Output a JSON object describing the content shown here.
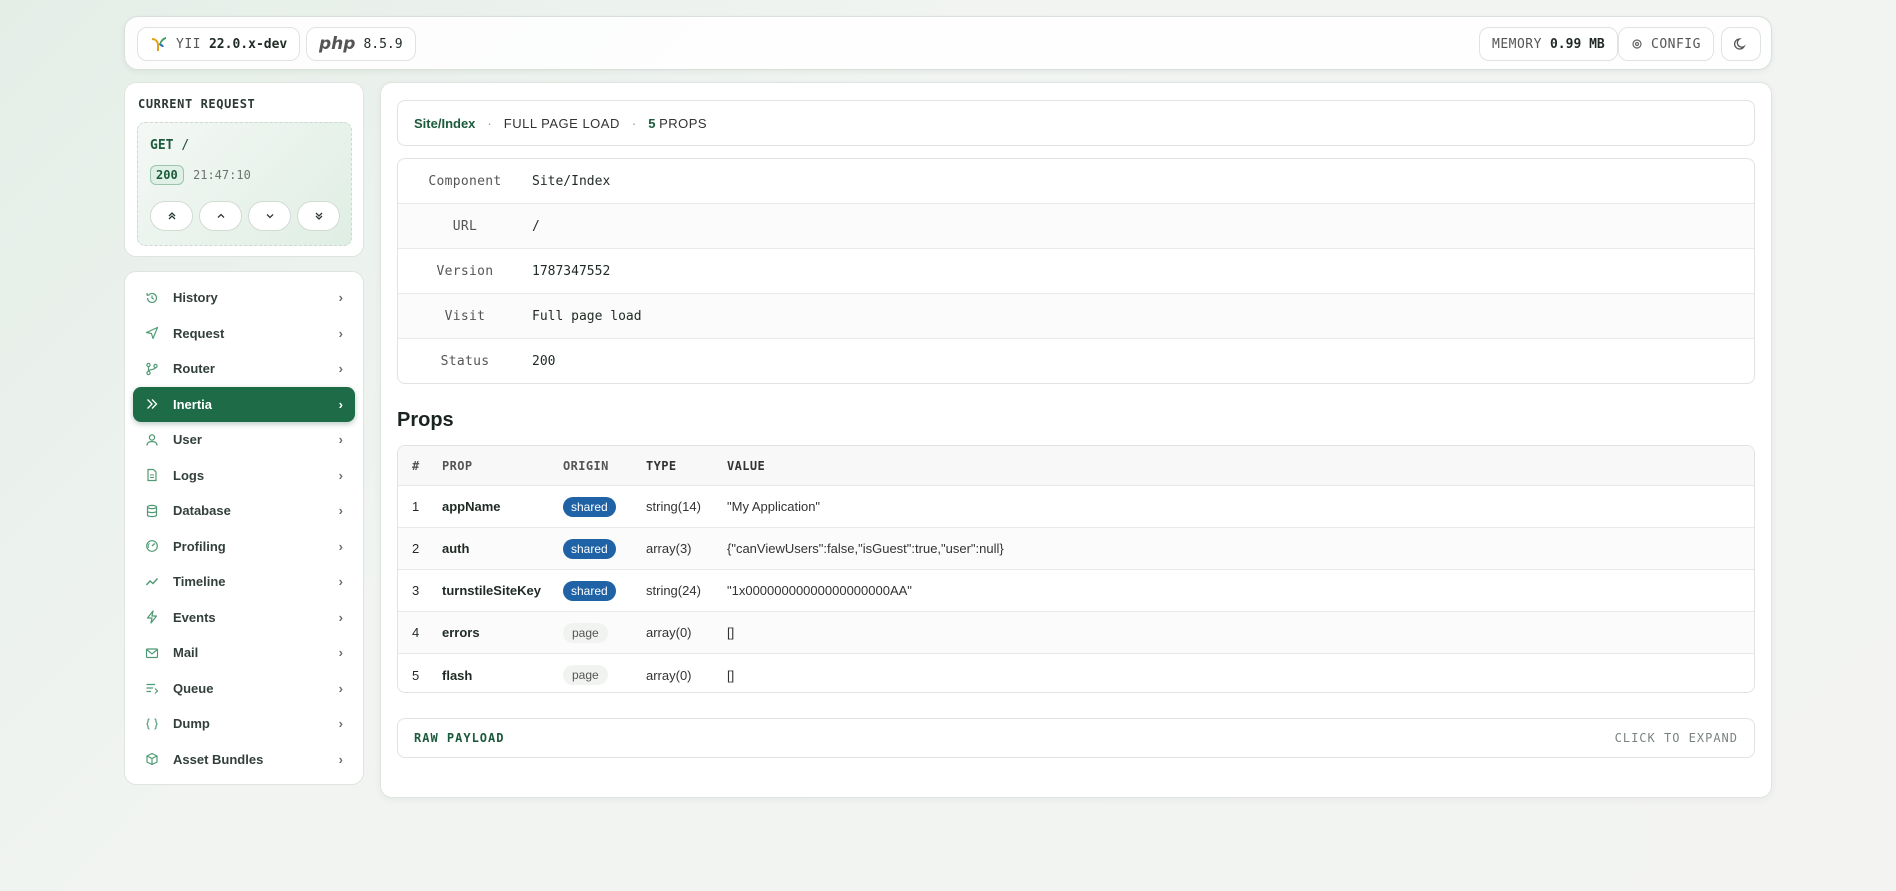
{
  "topbar": {
    "framework_label": "YII",
    "framework_version": "22.0.x-dev",
    "php_label": "php",
    "php_version": "8.5.9",
    "memory_label": "MEMORY",
    "memory_value": "0.99 MB",
    "config_label": "CONFIG"
  },
  "request": {
    "title": "CURRENT REQUEST",
    "method": "GET",
    "path": "/",
    "status": "200",
    "time": "21:47:10"
  },
  "menu": [
    {
      "label": "History",
      "icon": "history-icon"
    },
    {
      "label": "Request",
      "icon": "send-icon"
    },
    {
      "label": "Router",
      "icon": "git-branch-icon"
    },
    {
      "label": "Inertia",
      "icon": "double-chevron-icon",
      "active": true
    },
    {
      "label": "User",
      "icon": "user-icon"
    },
    {
      "label": "Logs",
      "icon": "file-icon"
    },
    {
      "label": "Database",
      "icon": "database-icon"
    },
    {
      "label": "Profiling",
      "icon": "gauge-icon"
    },
    {
      "label": "Timeline",
      "icon": "trend-icon"
    },
    {
      "label": "Events",
      "icon": "lightning-icon"
    },
    {
      "label": "Mail",
      "icon": "mail-icon"
    },
    {
      "label": "Queue",
      "icon": "queue-icon"
    },
    {
      "label": "Dump",
      "icon": "braces-icon"
    },
    {
      "label": "Asset Bundles",
      "icon": "package-icon"
    }
  ],
  "main": {
    "crumb": {
      "component": "Site/Index",
      "sep": "·",
      "load": "FULL PAGE LOAD",
      "props_count": "5",
      "props_label": "PROPS"
    },
    "details": [
      {
        "key": "Component",
        "value": "Site/Index"
      },
      {
        "key": "URL",
        "value": "/"
      },
      {
        "key": "Version",
        "value": "1787347552"
      },
      {
        "key": "Visit",
        "value": "Full page load"
      },
      {
        "key": "Status",
        "value": "200"
      }
    ],
    "props_title": "Props",
    "props_headers": [
      "#",
      "PROP",
      "ORIGIN",
      "TYPE",
      "VALUE"
    ],
    "props": [
      {
        "idx": "1",
        "prop": "appName",
        "origin": "shared",
        "type": "string(14)",
        "value": "\"My Application\""
      },
      {
        "idx": "2",
        "prop": "auth",
        "origin": "shared",
        "type": "array(3)",
        "value": "{\"canViewUsers\":false,\"isGuest\":true,\"user\":null}"
      },
      {
        "idx": "3",
        "prop": "turnstileSiteKey",
        "origin": "shared",
        "type": "string(24)",
        "value": "\"1x00000000000000000000AA\""
      },
      {
        "idx": "4",
        "prop": "errors",
        "origin": "page",
        "type": "array(0)",
        "value": "[]"
      },
      {
        "idx": "5",
        "prop": "flash",
        "origin": "page",
        "type": "array(0)",
        "value": "[]"
      }
    ],
    "raw_label": "RAW PAYLOAD",
    "raw_action": "CLICK TO EXPAND"
  },
  "colors": {
    "accent": "#1d6b47",
    "shared_badge": "#1f63a6",
    "background": "#eef3ef"
  }
}
